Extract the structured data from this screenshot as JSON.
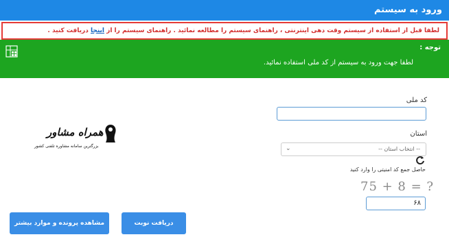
{
  "header": {
    "title": "ورود به سیستم"
  },
  "notice": {
    "text_before": "لطفا قبل از استفاده از سیستم وقت دهی اینترنتی ، راهنمای سیستم را مطالعه نمائید . راهنمای سیستم را از",
    "link_text": "اینجا",
    "text_after": "دریافت کنید ."
  },
  "alert": {
    "title": "توجه :",
    "message": "لطفا جهت ورود به سیستم از کد ملی استفاده نمائید."
  },
  "form": {
    "national_code_label": "کد ملی",
    "national_code_value": "",
    "province_label": "استان",
    "province_selected": "-- انتخاب استان --",
    "captcha_instruction": "حاصل جمع کد امنیتی را وارد کنید",
    "captcha_text": "75 + 8 = ?",
    "captcha_answer": "۶۸"
  },
  "logo": {
    "name": "همراه مشاور",
    "tagline": "بزرگترین سامانه مشاوره تلفنی کشور"
  },
  "buttons": {
    "view_file": "مشاهده پرونده و موارد بیشتر",
    "get_appointment": "دریافت نوبت"
  },
  "colors": {
    "header_bg": "#1e88e5",
    "alert_bg": "#1da520",
    "notice_border": "#e53935",
    "button_bg": "#3a8ee6"
  }
}
